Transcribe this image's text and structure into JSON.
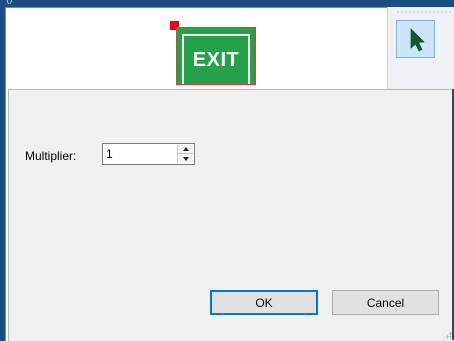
{
  "window": {
    "title_fragment": "()",
    "exit_sign_text": "EXIT"
  },
  "toolbar": {
    "pointer_tool": "arrow-pointer-icon"
  },
  "dialog": {
    "multiplier_label": "Multiplier:",
    "multiplier_value": "1",
    "ok_label": "OK",
    "cancel_label": "Cancel"
  },
  "colors": {
    "frame": "#1a4f86",
    "exit_green": "#23a24a",
    "selection_handle": "#e8001c",
    "ok_border": "#0078d7"
  }
}
